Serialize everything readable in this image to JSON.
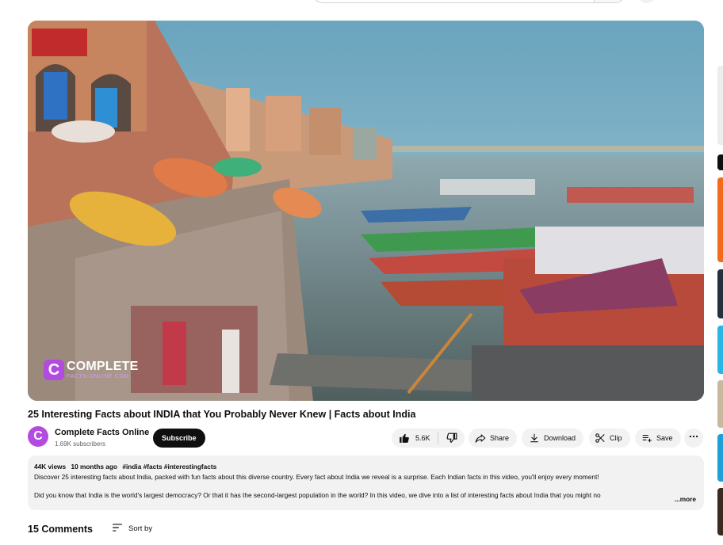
{
  "video": {
    "title": "25 Interesting Facts about INDIA that You Probably Never Knew | Facts about India",
    "watermark_logo": "C",
    "watermark_main": "COMPLETE",
    "watermark_sub": "FACTS-ONLINE.COM"
  },
  "channel": {
    "avatar_letter": "C",
    "name": "Complete Facts Online",
    "subscribers": "1.69K subscribers",
    "subscribe_label": "Subscribe",
    "accent": "#b44be0"
  },
  "actions": {
    "like_count": "5.6K",
    "share_label": "Share",
    "download_label": "Download",
    "clip_label": "Clip",
    "save_label": "Save"
  },
  "description": {
    "views": "44K views",
    "age": "10 months ago",
    "tags": "#india #facts #interestingfacts",
    "line1": "Discover 25 interesting facts about India, packed with fun facts about this diverse country. Every fact about India we reveal is a surprise. Each Indian facts in this video, you'll enjoy every moment!",
    "line2": "Did you know that India is the world's largest democracy? Or that it has the second-largest population in the world? In this video, we dive into a list of interesting facts about India that you might no",
    "more_label": "...more"
  },
  "comments": {
    "count_label": "15 Comments",
    "sort_label": "Sort by"
  },
  "icons": {
    "like": "thumbs-up-icon",
    "dislike": "thumbs-down-icon",
    "share": "share-icon",
    "download": "download-icon",
    "clip": "scissors-icon",
    "save": "playlist-add-icon",
    "more": "more-horizontal-icon",
    "sort": "sort-icon"
  }
}
